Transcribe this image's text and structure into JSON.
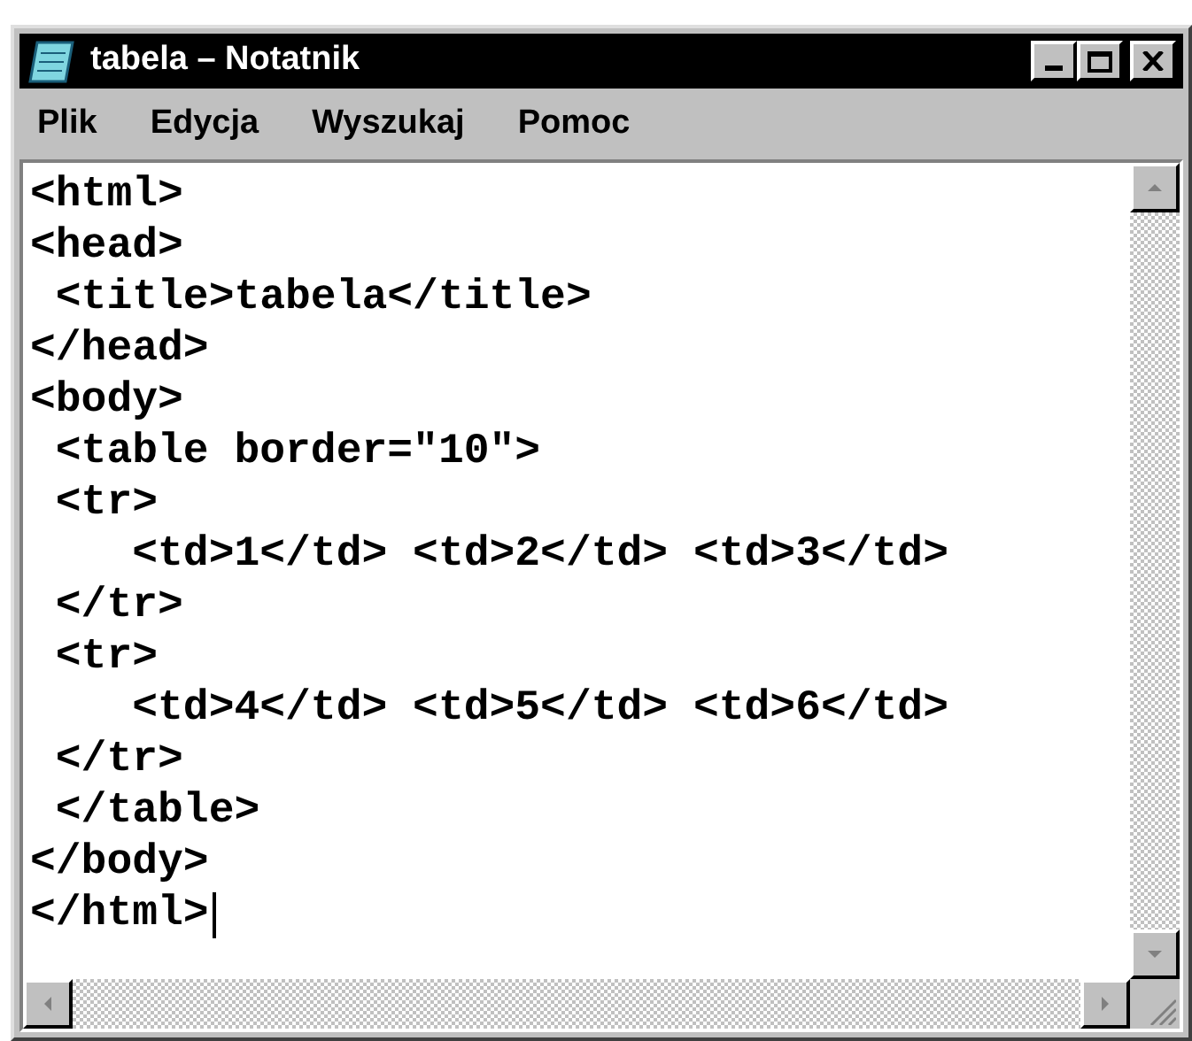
{
  "window": {
    "title": "tabela – Notatnik"
  },
  "menu": [
    "Plik",
    "Edycja",
    "Wyszukaj",
    "Pomoc"
  ],
  "editor": {
    "lines": [
      "<html>",
      "<head>",
      " <title>tabela</title>",
      "</head>",
      "<body>",
      " <table border=\"10\">",
      " <tr>",
      "    <td>1</td> <td>2</td> <td>3</td>",
      " </tr>",
      " <tr>",
      "    <td>4</td> <td>5</td> <td>6</td>",
      " </tr>",
      " </table>",
      "</body>",
      "</html>"
    ]
  }
}
